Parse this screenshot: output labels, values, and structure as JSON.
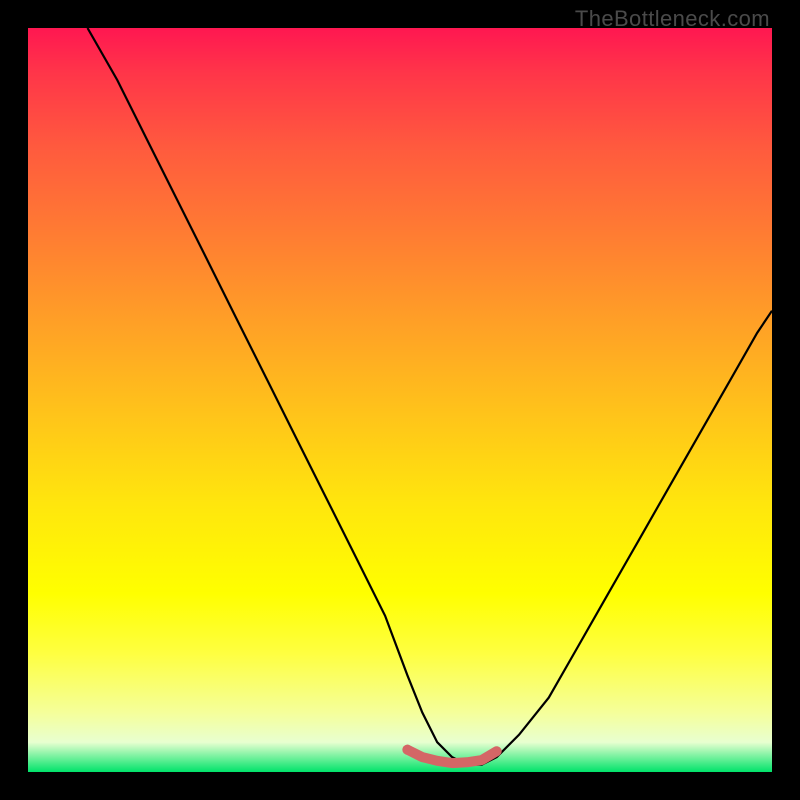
{
  "watermark": "TheBottleneck.com",
  "chart_data": {
    "type": "line",
    "title": "",
    "xlabel": "",
    "ylabel": "",
    "xlim": [
      0,
      100
    ],
    "ylim": [
      0,
      100
    ],
    "series": [
      {
        "name": "bottleneck-curve",
        "x": [
          8,
          12,
          16,
          20,
          24,
          28,
          32,
          36,
          40,
          44,
          48,
          51,
          53,
          55,
          57,
          59,
          61,
          63,
          66,
          70,
          74,
          78,
          82,
          86,
          90,
          94,
          98,
          100
        ],
        "values": [
          100,
          93,
          85,
          77,
          69,
          61,
          53,
          45,
          37,
          29,
          21,
          13,
          8,
          4,
          2,
          1,
          1,
          2,
          5,
          10,
          17,
          24,
          31,
          38,
          45,
          52,
          59,
          62
        ]
      },
      {
        "name": "optimal-band",
        "x": [
          51,
          53,
          55,
          57,
          59,
          61,
          63
        ],
        "values": [
          3,
          2,
          1.5,
          1.2,
          1.3,
          1.6,
          2.8
        ]
      }
    ],
    "colors": {
      "curve": "#000000",
      "optimal": "#d46666"
    }
  }
}
